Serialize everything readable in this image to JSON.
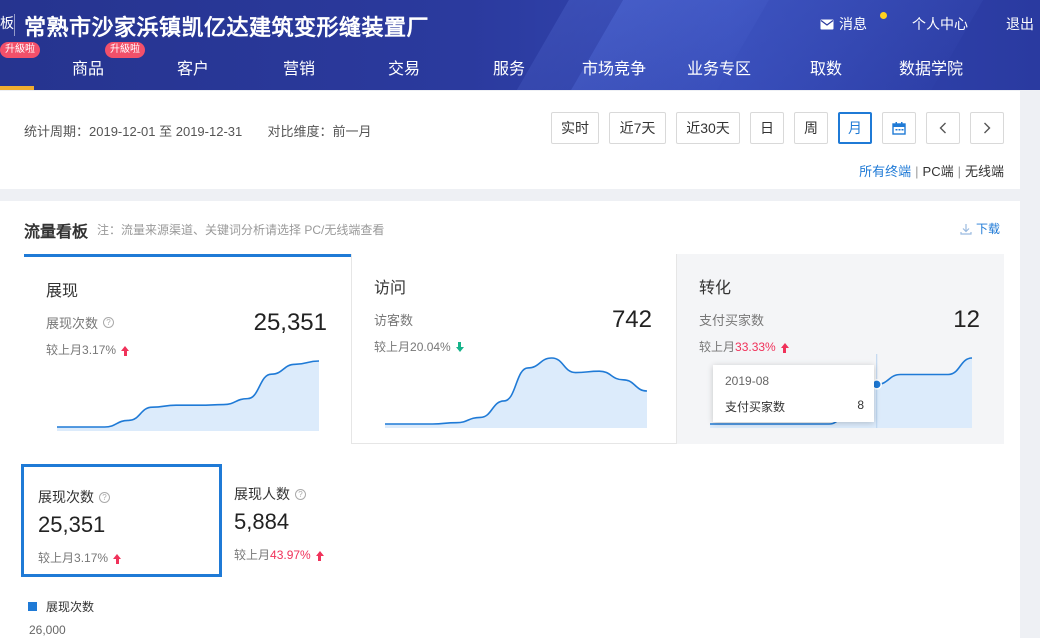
{
  "header": {
    "edge_char": "板",
    "company": "常熟市沙家浜镇凯亿达建筑变形缝装置厂",
    "messages_label": "消息",
    "personal_center_label": "个人中心",
    "logout_label": "退出"
  },
  "nav": {
    "upgrade_badge": "升級啦",
    "items": [
      {
        "label": "商品"
      },
      {
        "label": "客户"
      },
      {
        "label": "营销"
      },
      {
        "label": "交易"
      },
      {
        "label": "服务"
      },
      {
        "label": "市场竞争"
      },
      {
        "label": "业务专区"
      },
      {
        "label": "取数"
      },
      {
        "label": "数据学院"
      }
    ]
  },
  "filter": {
    "period_label": "统计周期：",
    "period_value": "2019-12-01 至 2019-12-31",
    "compare_label": "对比维度：",
    "compare_value": "前一月",
    "buttons": {
      "realtime": "实时",
      "last7": "近7天",
      "last30": "近30天",
      "day": "日",
      "week": "周",
      "month": "月"
    },
    "active_button": "月",
    "terminals": {
      "all": "所有终端",
      "pc": "PC端",
      "wireless": "无线端",
      "selected": "所有终端"
    }
  },
  "board": {
    "title": "流量看板",
    "note": "注：流量来源渠道、关键词分析请选择 PC/无线端查看",
    "download_label": "下载"
  },
  "metrics": [
    {
      "title": "展现",
      "label": "展现次数",
      "value": "25,351",
      "comp_prefix": "较上月",
      "comp_pct": "3.17%",
      "trend": "up",
      "spark": [
        0,
        0,
        0,
        0.1,
        0.3,
        0.33,
        0.33,
        0.34,
        0.43,
        0.8,
        0.95,
        1
      ]
    },
    {
      "title": "访问",
      "label": "访客数",
      "value": "742",
      "comp_prefix": "较上月",
      "comp_pct": "20.04%",
      "trend": "down",
      "spark": [
        0,
        0,
        0,
        0.02,
        0.1,
        0.35,
        0.85,
        1,
        0.78,
        0.8,
        0.67,
        0.5
      ]
    },
    {
      "title": "转化",
      "label": "支付买家数",
      "value": "12",
      "comp_prefix": "较上月",
      "comp_pct": "33.33%",
      "trend": "up",
      "spark": [
        0,
        0,
        0,
        0,
        0,
        0,
        0.22,
        0.6,
        0.75,
        0.75,
        0.75,
        1
      ]
    }
  ],
  "tooltip": {
    "date": "2019-08",
    "name": "支付买家数",
    "value": "8"
  },
  "sub_metrics": [
    {
      "title": "展现次数",
      "value": "25,351",
      "comp_prefix": "较上月",
      "comp_pct": "3.17%",
      "trend": "up"
    },
    {
      "title": "展现人数",
      "value": "5,884",
      "comp_prefix": "较上月",
      "comp_pct": "43.97%",
      "trend": "up"
    }
  ],
  "detail_chart": {
    "legend": "展现次数",
    "y_tick_top": "26,000"
  },
  "colors": {
    "accent": "#1f7ad6",
    "up": "#f0325a",
    "down": "#16b38a",
    "header": "#2b3a9e",
    "badge": "#f2506a",
    "spark_fill": "#dcebfb"
  }
}
